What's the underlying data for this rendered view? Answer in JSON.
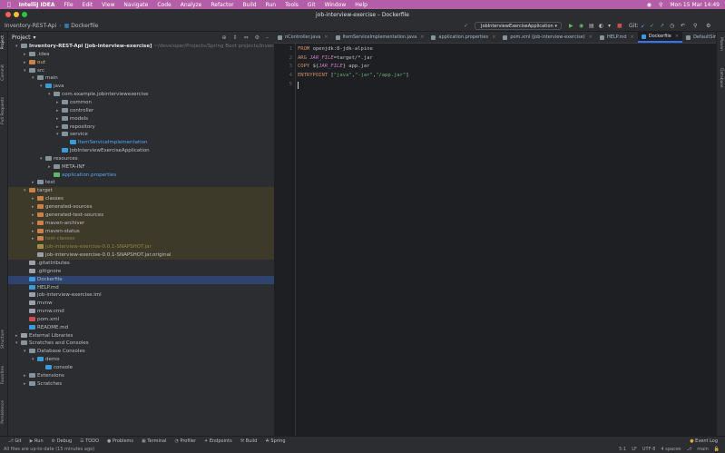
{
  "menubar": {
    "app": "IntelliJ IDEA",
    "items": [
      "File",
      "Edit",
      "View",
      "Navigate",
      "Code",
      "Analyze",
      "Refactor",
      "Build",
      "Run",
      "Tools",
      "Git",
      "Window",
      "Help"
    ],
    "clock": "Mon 15 Mar  14:49"
  },
  "window": {
    "title": "job-interview-exercise – Dockerfile"
  },
  "navbar": {
    "project": "Inventory-REST-Api",
    "file": "Dockerfile",
    "run_config": "JobInterviewExerciseApplication",
    "git_label": "Git:"
  },
  "left_stripe": [
    "Project",
    "Commit",
    "Pull Requests",
    "Structure",
    "Favorites",
    "Persistence"
  ],
  "right_stripe": [
    "Maven",
    "Database"
  ],
  "project_panel": {
    "title": "Project",
    "tree": [
      {
        "text": "Inventory-REST-Api [job-interview-exercise]",
        "suffix": " ~/developer/Projects/Spring Boot projects/Inventory-R",
        "indent": 0,
        "arrow": "v",
        "icon": "folder",
        "color": "#dfe1e5"
      },
      {
        "text": ".idea",
        "indent": 1,
        "arrow": ">",
        "icon": "folder"
      },
      {
        "text": "out",
        "indent": 1,
        "arrow": ">",
        "icon": "folder-orange",
        "color": "#d5b778"
      },
      {
        "text": "src",
        "indent": 1,
        "arrow": "v",
        "icon": "folder"
      },
      {
        "text": "main",
        "indent": 2,
        "arrow": "v",
        "icon": "folder"
      },
      {
        "text": "java",
        "indent": 3,
        "arrow": "v",
        "icon": "folder-blue"
      },
      {
        "text": "com.example.jobinterviewexercise",
        "indent": 4,
        "arrow": "v",
        "icon": "package"
      },
      {
        "text": "common",
        "indent": 5,
        "arrow": ">",
        "icon": "package"
      },
      {
        "text": "controller",
        "indent": 5,
        "arrow": ">",
        "icon": "package"
      },
      {
        "text": "models",
        "indent": 5,
        "arrow": ">",
        "icon": "package"
      },
      {
        "text": "repository",
        "indent": 5,
        "arrow": ">",
        "icon": "package"
      },
      {
        "text": "service",
        "indent": 5,
        "arrow": "v",
        "icon": "package"
      },
      {
        "text": "ItemServiceImplementation",
        "indent": 6,
        "arrow": "",
        "icon": "class",
        "color": "#56a8f5"
      },
      {
        "text": "JobInterviewExerciseApplication",
        "indent": 5,
        "arrow": "",
        "icon": "class"
      },
      {
        "text": "resources",
        "indent": 3,
        "arrow": "v",
        "icon": "folder"
      },
      {
        "text": "META-INF",
        "indent": 4,
        "arrow": ">",
        "icon": "folder"
      },
      {
        "text": "application.properties",
        "indent": 4,
        "arrow": "",
        "icon": "props",
        "color": "#56a8f5"
      },
      {
        "text": "test",
        "indent": 2,
        "arrow": ">",
        "icon": "folder"
      },
      {
        "text": "target",
        "indent": 1,
        "arrow": "v",
        "icon": "folder-orange",
        "hl": "target"
      },
      {
        "text": "classes",
        "indent": 2,
        "arrow": ">",
        "icon": "folder-orange",
        "hl": "target"
      },
      {
        "text": "generated-sources",
        "indent": 2,
        "arrow": ">",
        "icon": "folder-orange",
        "hl": "target"
      },
      {
        "text": "generated-test-sources",
        "indent": 2,
        "arrow": ">",
        "icon": "folder-orange",
        "hl": "target"
      },
      {
        "text": "maven-archiver",
        "indent": 2,
        "arrow": ">",
        "icon": "folder-orange",
        "hl": "target"
      },
      {
        "text": "maven-status",
        "indent": 2,
        "arrow": ">",
        "icon": "folder-orange",
        "hl": "target"
      },
      {
        "text": "test-classes",
        "indent": 2,
        "arrow": ">",
        "icon": "folder-orange",
        "hl": "target",
        "color": "#8a8347"
      },
      {
        "text": "job-interview-exercise-0.0.1-SNAPSHOT.jar",
        "indent": 2,
        "arrow": "",
        "icon": "jar",
        "hl": "target",
        "color": "#8a8347"
      },
      {
        "text": "job-interview-exercise-0.0.1-SNAPSHOT.jar.original",
        "indent": 2,
        "arrow": "",
        "icon": "file",
        "hl": "target"
      },
      {
        "text": ".gitattributes",
        "indent": 1,
        "arrow": "",
        "icon": "file"
      },
      {
        "text": ".gitignore",
        "indent": 1,
        "arrow": "",
        "icon": "file"
      },
      {
        "text": "Dockerfile",
        "indent": 1,
        "arrow": "",
        "icon": "docker",
        "hl": "sel"
      },
      {
        "text": "HELP.md",
        "indent": 1,
        "arrow": "",
        "icon": "md"
      },
      {
        "text": "job-interview-exercise.iml",
        "indent": 1,
        "arrow": "",
        "icon": "file"
      },
      {
        "text": "mvnw",
        "indent": 1,
        "arrow": "",
        "icon": "file"
      },
      {
        "text": "mvnw.cmd",
        "indent": 1,
        "arrow": "",
        "icon": "file"
      },
      {
        "text": "pom.xml",
        "indent": 1,
        "arrow": "",
        "icon": "maven"
      },
      {
        "text": "README.md",
        "indent": 1,
        "arrow": "",
        "icon": "md"
      },
      {
        "text": "External Libraries",
        "indent": 0,
        "arrow": ">",
        "icon": "lib"
      },
      {
        "text": "Scratches and Consoles",
        "indent": 0,
        "arrow": "v",
        "icon": "folder"
      },
      {
        "text": "Database Consoles",
        "indent": 1,
        "arrow": "v",
        "icon": "folder"
      },
      {
        "text": "demo",
        "indent": 2,
        "arrow": "v",
        "icon": "db"
      },
      {
        "text": "console",
        "indent": 3,
        "arrow": "",
        "icon": "console"
      },
      {
        "text": "Extensions",
        "indent": 1,
        "arrow": ">",
        "icon": "folder"
      },
      {
        "text": "Scratches",
        "indent": 1,
        "arrow": ">",
        "icon": "folder"
      }
    ]
  },
  "tabs": [
    {
      "label": "nController.java"
    },
    {
      "label": "ItemServiceImplementation.java"
    },
    {
      "label": "application.properties"
    },
    {
      "label": "pom.xml (job-interview-exercise)"
    },
    {
      "label": "HELP.md"
    },
    {
      "label": "Dockerfile",
      "active": true
    },
    {
      "label": "DefaultSingletonBeanRegistry."
    }
  ],
  "editor": {
    "line_numbers": [
      "1",
      "2",
      "3",
      "4",
      "5"
    ],
    "lines": [
      [
        {
          "t": "FROM ",
          "c": "kw"
        },
        {
          "t": "openjdk:8-jdk-alpine",
          "c": "plain"
        }
      ],
      [
        {
          "t": "ARG ",
          "c": "kw"
        },
        {
          "t": "JAR_FILE",
          "c": "arg"
        },
        {
          "t": "=target/*.jar",
          "c": "plain"
        }
      ],
      [
        {
          "t": "COPY ",
          "c": "kw"
        },
        {
          "t": "${",
          "c": "plain"
        },
        {
          "t": "JAR_FILE",
          "c": "arg"
        },
        {
          "t": "} app.jar",
          "c": "plain"
        }
      ],
      [
        {
          "t": "ENTRYPOINT ",
          "c": "kw"
        },
        {
          "t": "[",
          "c": "plain"
        },
        {
          "t": "\"java\"",
          "c": "str"
        },
        {
          "t": ",",
          "c": "plain"
        },
        {
          "t": "\"-jar\"",
          "c": "str"
        },
        {
          "t": ",",
          "c": "plain"
        },
        {
          "t": "\"/app.jar\"",
          "c": "str"
        },
        {
          "t": "]",
          "c": "plain"
        }
      ],
      []
    ]
  },
  "tool_windows": [
    "Git",
    "Run",
    "Debug",
    "TODO",
    "Problems",
    "Terminal",
    "Profiler",
    "Endpoints",
    "Build",
    "Spring"
  ],
  "event_log": "Event Log",
  "status": {
    "message": "All files are up-to-date (15 minutes ago)",
    "position": "5:1",
    "line_sep": "LF",
    "encoding": "UTF-8",
    "indent": "4 spaces",
    "branch": "main"
  },
  "colors": {
    "menubar": "#b45ea8",
    "accent": "#3574f0",
    "selection": "#2e436e",
    "excluded": "#3e3a2a"
  }
}
